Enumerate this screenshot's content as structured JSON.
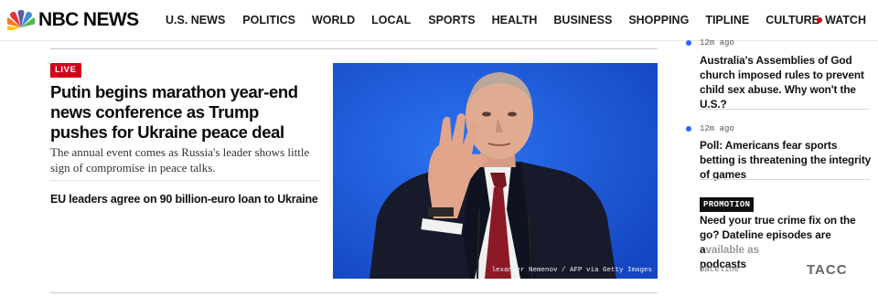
{
  "header": {
    "logo_text": "NBC NEWS",
    "nav": [
      "U.S. NEWS",
      "POLITICS",
      "WORLD",
      "LOCAL",
      "SPORTS",
      "HEALTH",
      "BUSINESS",
      "SHOPPING",
      "TIPLINE",
      "CULTURE"
    ],
    "watch_label": "WATCH"
  },
  "lead": {
    "badge": "LIVE",
    "headline": "Putin begins marathon year-end news conference as Trump pushes for Ukraine peace deal",
    "dek": "The annual event comes as Russia's leader shows little sign of compromise in peace talks.",
    "related": "EU leaders agree on 90 billion-euro loan to Ukraine",
    "photo_credit": "lexander Nemenov / AFP via Getty Images"
  },
  "rail": {
    "items": [
      {
        "time": "12m ago",
        "title": "Australia's Assemblies of God church imposed rules to prevent child sex abuse. Why won't the U.S.?"
      },
      {
        "time": "12m ago",
        "title": "Poll: Americans fear sports betting is threatening the integrity of games"
      }
    ],
    "promo": {
      "tag": "PROMOTION",
      "title_main": "Need your true crime fix on the go? Dateline episodes are a",
      "title_faded": "vailable as",
      "title_end": "podcasts",
      "source": "Dateline",
      "partner_logo": "TACC"
    }
  },
  "colors": {
    "live_red": "#d0021b",
    "rail_dot_blue": "#3061ff",
    "photo_background": "#1e5ce0"
  },
  "icons": [
    "nbc-peacock-icon",
    "live-dot-icon",
    "bullet-dot-icon"
  ]
}
